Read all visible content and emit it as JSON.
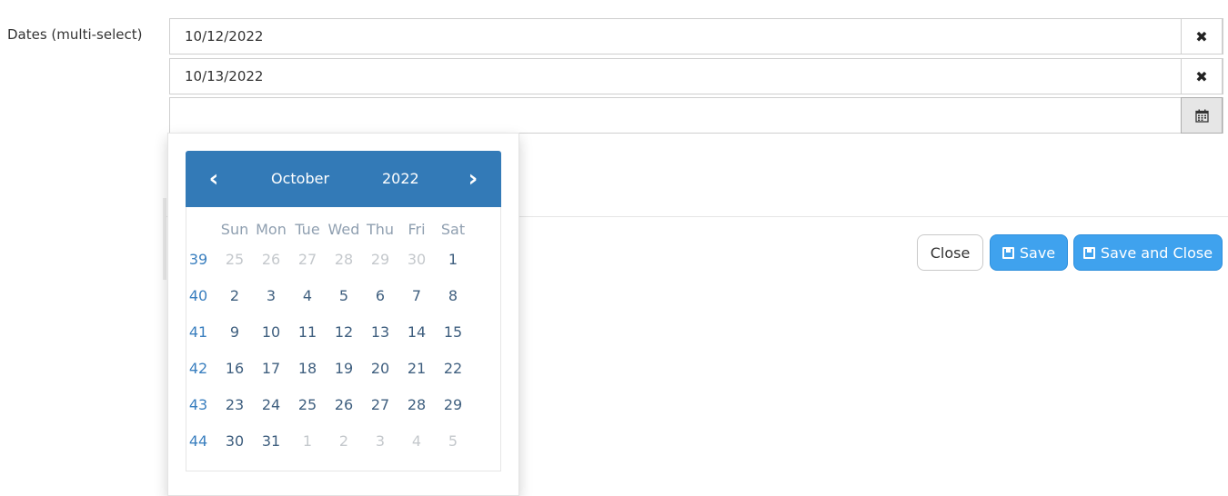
{
  "form": {
    "label": "Dates (multi-select)",
    "dates": [
      {
        "value": "10/12/2022",
        "action_icon": "close-icon"
      },
      {
        "value": "10/13/2022",
        "action_icon": "close-icon"
      }
    ],
    "new_date": {
      "value": "",
      "action_icon": "calendar-icon"
    }
  },
  "datepicker": {
    "month": "October",
    "year": "2022",
    "prev_icon": "chevron-left-icon",
    "next_icon": "chevron-right-icon",
    "weekdays": [
      "Sun",
      "Mon",
      "Tue",
      "Wed",
      "Thu",
      "Fri",
      "Sat"
    ],
    "weeks": [
      {
        "number": "39",
        "days": [
          "25",
          "26",
          "27",
          "28",
          "29",
          "30",
          "1"
        ]
      },
      {
        "number": "40",
        "days": [
          "2",
          "3",
          "4",
          "5",
          "6",
          "7",
          "8"
        ]
      },
      {
        "number": "41",
        "days": [
          "9",
          "10",
          "11",
          "12",
          "13",
          "14",
          "15"
        ]
      },
      {
        "number": "42",
        "days": [
          "16",
          "17",
          "18",
          "19",
          "20",
          "21",
          "22"
        ]
      },
      {
        "number": "43",
        "days": [
          "23",
          "24",
          "25",
          "26",
          "27",
          "28",
          "29"
        ]
      },
      {
        "number": "44",
        "days": [
          "30",
          "31",
          "1",
          "2",
          "3",
          "4",
          "5"
        ]
      }
    ],
    "header_color": "#337ab7"
  },
  "footer": {
    "close_label": "Close",
    "save_label": "Save",
    "save_close_label": "Save and Close",
    "button_color": "#3fa2ee"
  }
}
